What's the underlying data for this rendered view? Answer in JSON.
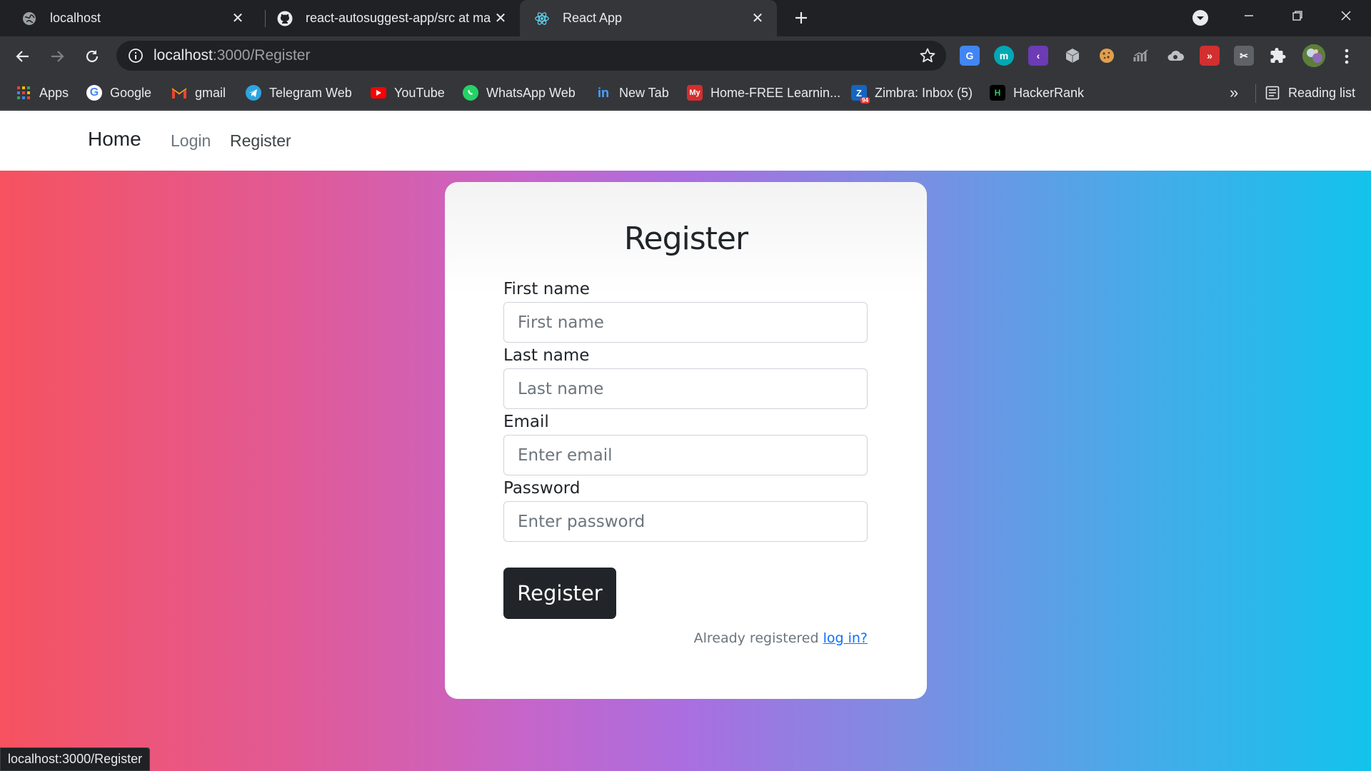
{
  "browser": {
    "tabs": [
      {
        "title": "localhost",
        "icon": "globe-icon"
      },
      {
        "title": "react-autosuggest-app/src at ma",
        "icon": "github-icon"
      },
      {
        "title": "React App",
        "icon": "react-icon",
        "active": true
      }
    ],
    "url_host": "localhost",
    "url_rest": ":3000/Register",
    "bookmarks": [
      {
        "label": "Apps",
        "icon": "apps-grid-icon",
        "color": "#4285f4"
      },
      {
        "label": "Google",
        "icon": "google-icon",
        "color": "#ffffff"
      },
      {
        "label": "gmail",
        "icon": "gmail-icon",
        "color": "#ea4335"
      },
      {
        "label": "Telegram Web",
        "icon": "telegram-icon",
        "color": "#2ca5e0"
      },
      {
        "label": "YouTube",
        "icon": "youtube-icon",
        "color": "#ff0000"
      },
      {
        "label": "WhatsApp Web",
        "icon": "whatsapp-icon",
        "color": "#25d366"
      },
      {
        "label": "New Tab",
        "icon": "linkedin-icon",
        "color": "#0a66c2"
      },
      {
        "label": "Home-FREE Learnin...",
        "icon": "my-icon",
        "color": "#d32f2f"
      },
      {
        "label": "Zimbra: Inbox (5)",
        "icon": "zimbra-icon",
        "color": "#e65100"
      },
      {
        "label": "HackerRank",
        "icon": "hackerrank-icon",
        "color": "#111111"
      }
    ],
    "overflow_label": "»",
    "reading_list": "Reading list",
    "status_text": "localhost:3000/Register"
  },
  "page": {
    "nav": {
      "brand": "Home",
      "links": [
        "Login",
        "Register"
      ]
    },
    "form": {
      "title": "Register",
      "fields": [
        {
          "label": "First name",
          "placeholder": "First name",
          "value": ""
        },
        {
          "label": "Last name",
          "placeholder": "Last name",
          "value": ""
        },
        {
          "label": "Email",
          "placeholder": "Enter email",
          "value": ""
        },
        {
          "label": "Password",
          "placeholder": "Enter password",
          "value": ""
        }
      ],
      "submit_label": "Register",
      "already_text": "Already registered",
      "login_link": "log in?"
    }
  },
  "colors": {
    "brand_dark": "#212529",
    "link": "#0d6efd",
    "gradient_left": "#f6525f",
    "gradient_mid": "#aa6ee0",
    "gradient_right": "#12c3ec"
  }
}
